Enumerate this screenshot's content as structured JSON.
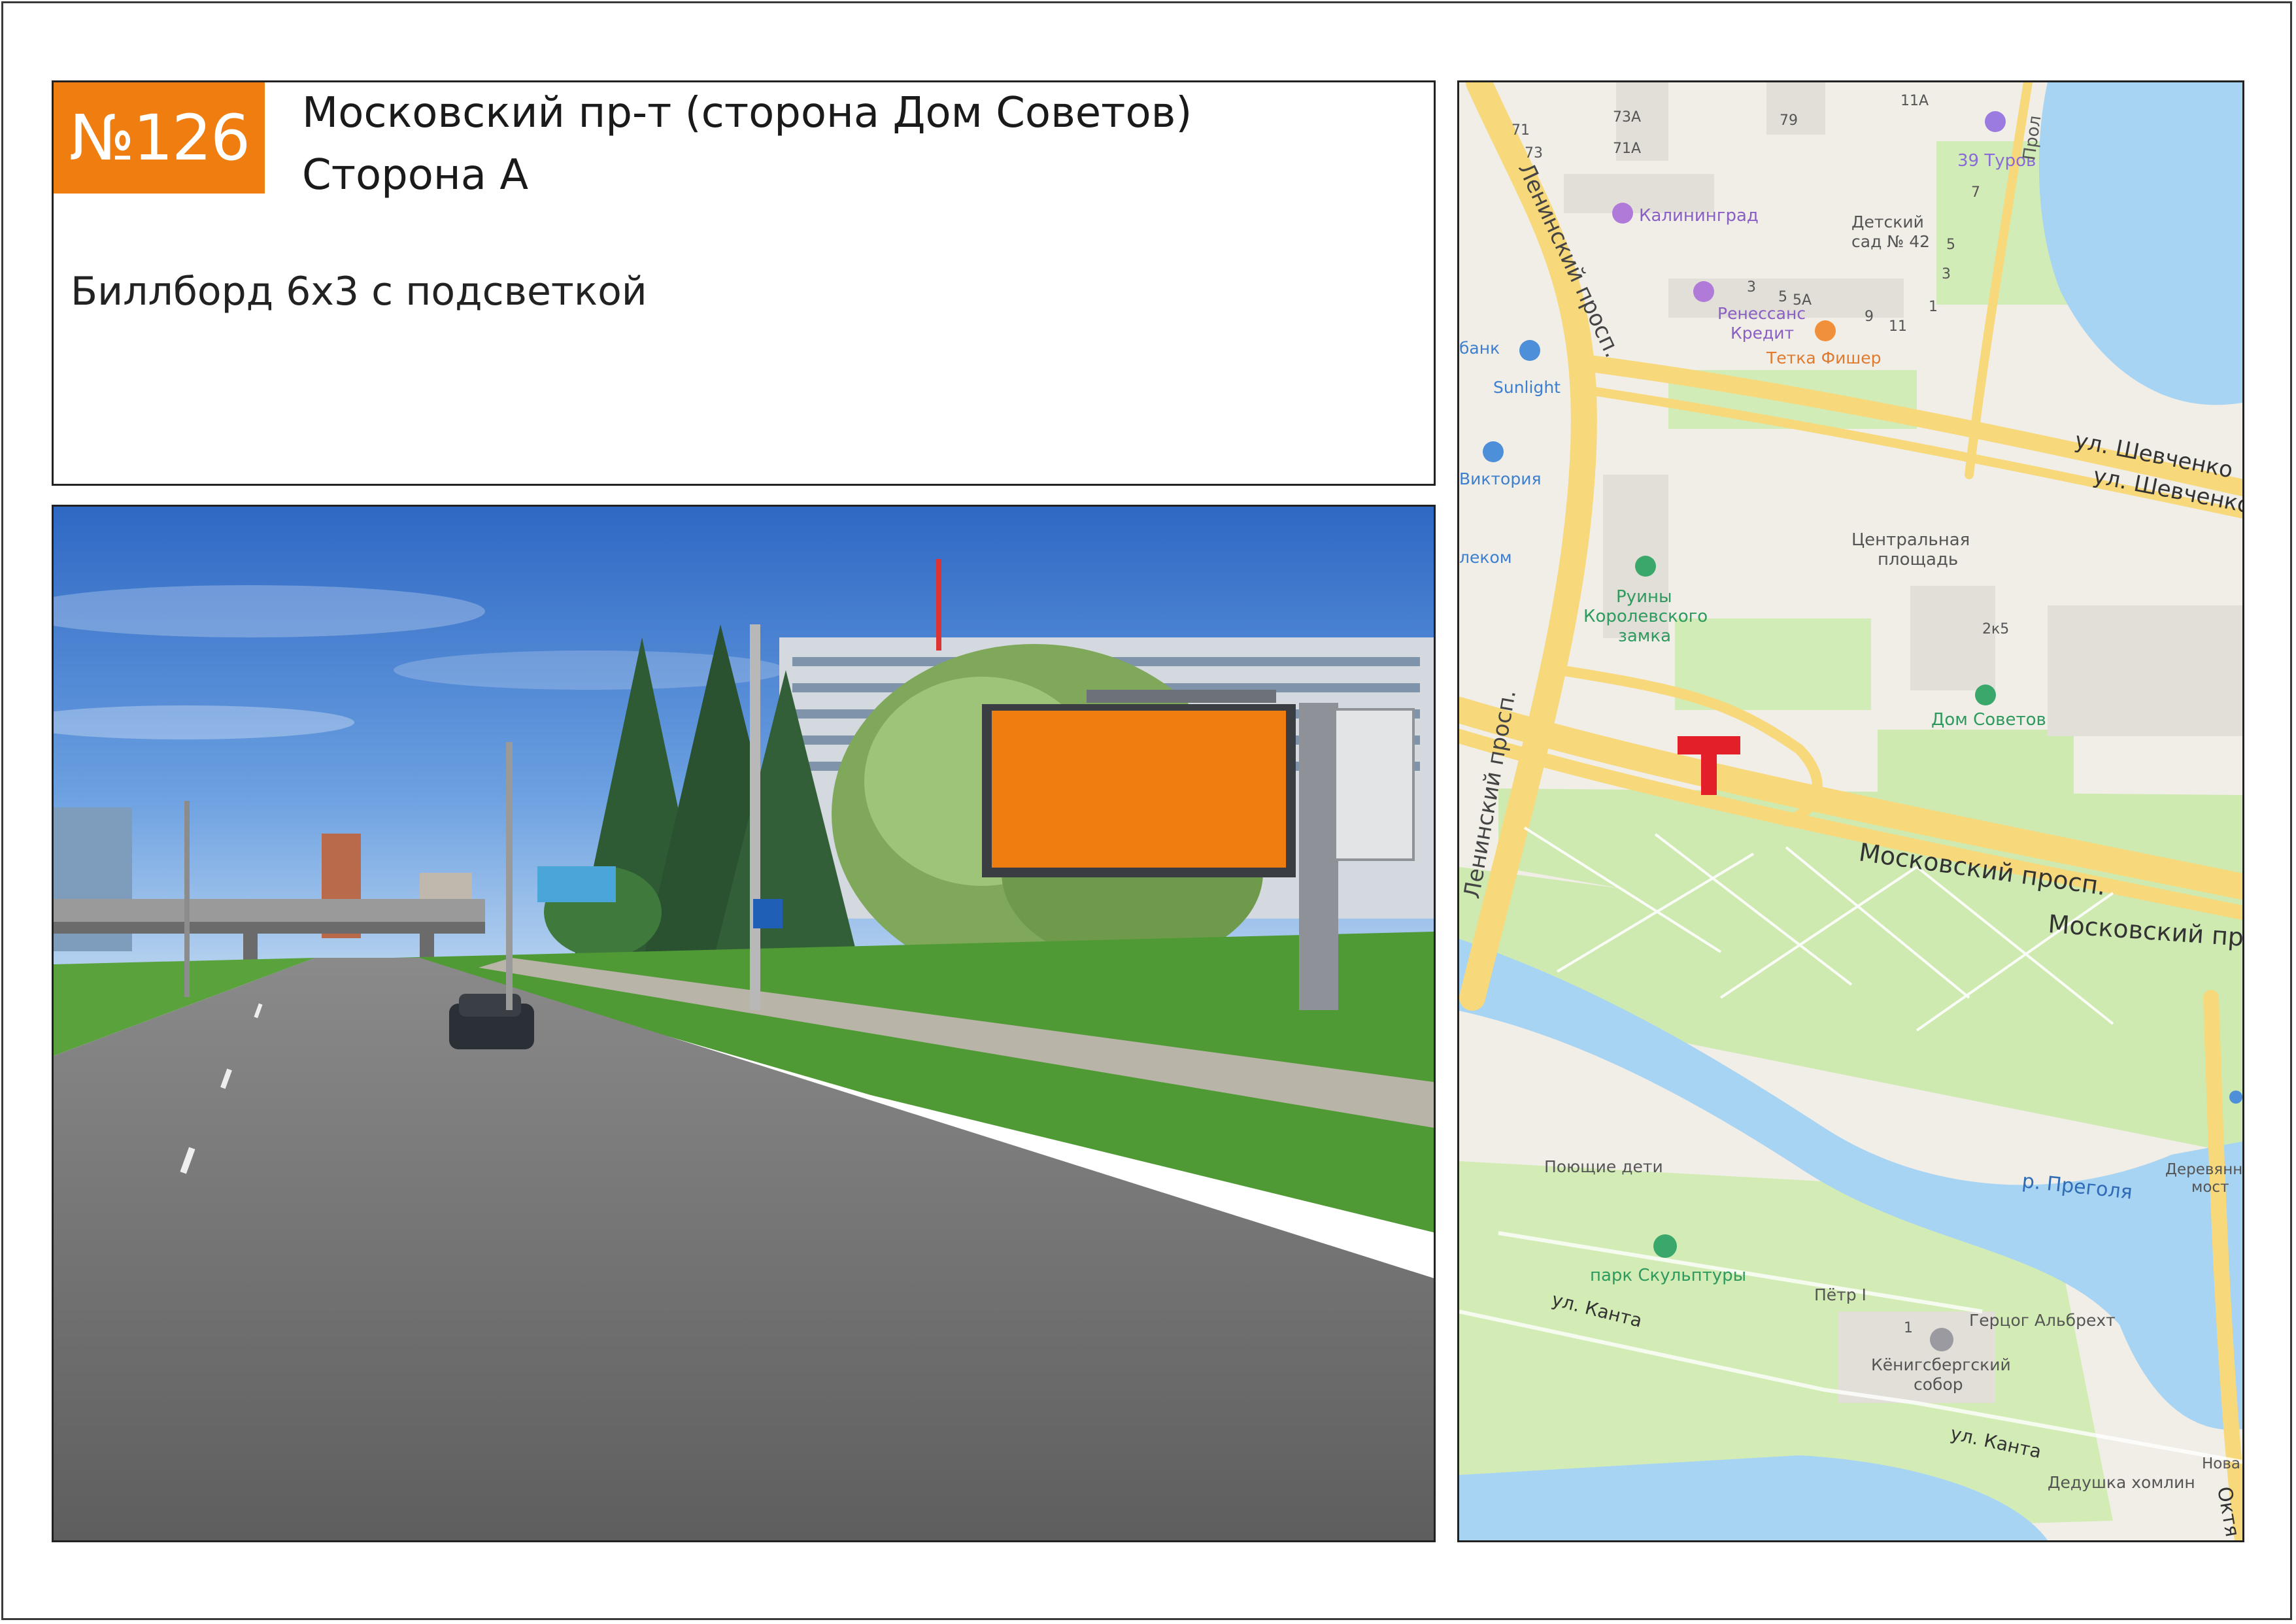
{
  "header": {
    "number": "№126",
    "title_line1": "Московский пр-т (сторона Дом Советов)",
    "title_line2": "Сторона А",
    "description": "Биллборд 6х3 с подсветкой"
  },
  "photo": {
    "billboard_color": "#ef7d10"
  },
  "map": {
    "marker_color": "#e3202a",
    "labels": {
      "n11a": "11А",
      "n79": "79",
      "n73a": "73А",
      "n71a": "71А",
      "n71": "71",
      "n73": "73",
      "n7": "7",
      "turov39": "39 Туров",
      "prol": "Прол",
      "kaliningrad": "Калининград",
      "kindergarten": "Детский сад № 42",
      "kindergarten_l1": "Детский",
      "kindergarten_l2": "сад № 42",
      "n5": "5",
      "n3": "3",
      "n1": "1",
      "n3b": "3",
      "n5b": "5",
      "n5a": "5А",
      "n9": "9",
      "n11": "11",
      "renaissance_l1": "Ренессанс",
      "renaissance_l2": "Кредит",
      "tetka": "Тетка Фишер",
      "bank": "банк",
      "sunlight": "Sunlight",
      "victoria": "Виктория",
      "lekom": "леком",
      "leninsky_top": "Ленинский просп.",
      "shevchenko1": "ул. Шевченко",
      "shevchenko2": "ул. Шевченко",
      "central_l1": "Центральная",
      "central_l2": "площадь",
      "ruins_l1": "Руины",
      "ruins_l2": "Королевского",
      "ruins_l3": "замка",
      "n2k5": "2к5",
      "dom_sovetov": "Дом Советов",
      "leninsky_bottom": "Ленинский просп.",
      "moskovsky1": "Московский просп.",
      "moskovsky2": "Московский пр",
      "singing_children": "Поющие дети",
      "pregolya": "р. Преголя",
      "wood_bridge_l1": "Деревянн",
      "wood_bridge_l2": "мост",
      "sculpture_park": "парк Скульптуры",
      "peter": "Пётр I",
      "kanta1": "ул. Канта",
      "albrecht": "Герцог Альбрехт",
      "cathedral_l1": "Кёнигсбергский",
      "cathedral_l2": "собор",
      "n1b": "1",
      "kanta2": "ул. Канта",
      "khomlin": "Дедушка хомлин",
      "nova": "Нова",
      "okt": "Октя"
    }
  }
}
